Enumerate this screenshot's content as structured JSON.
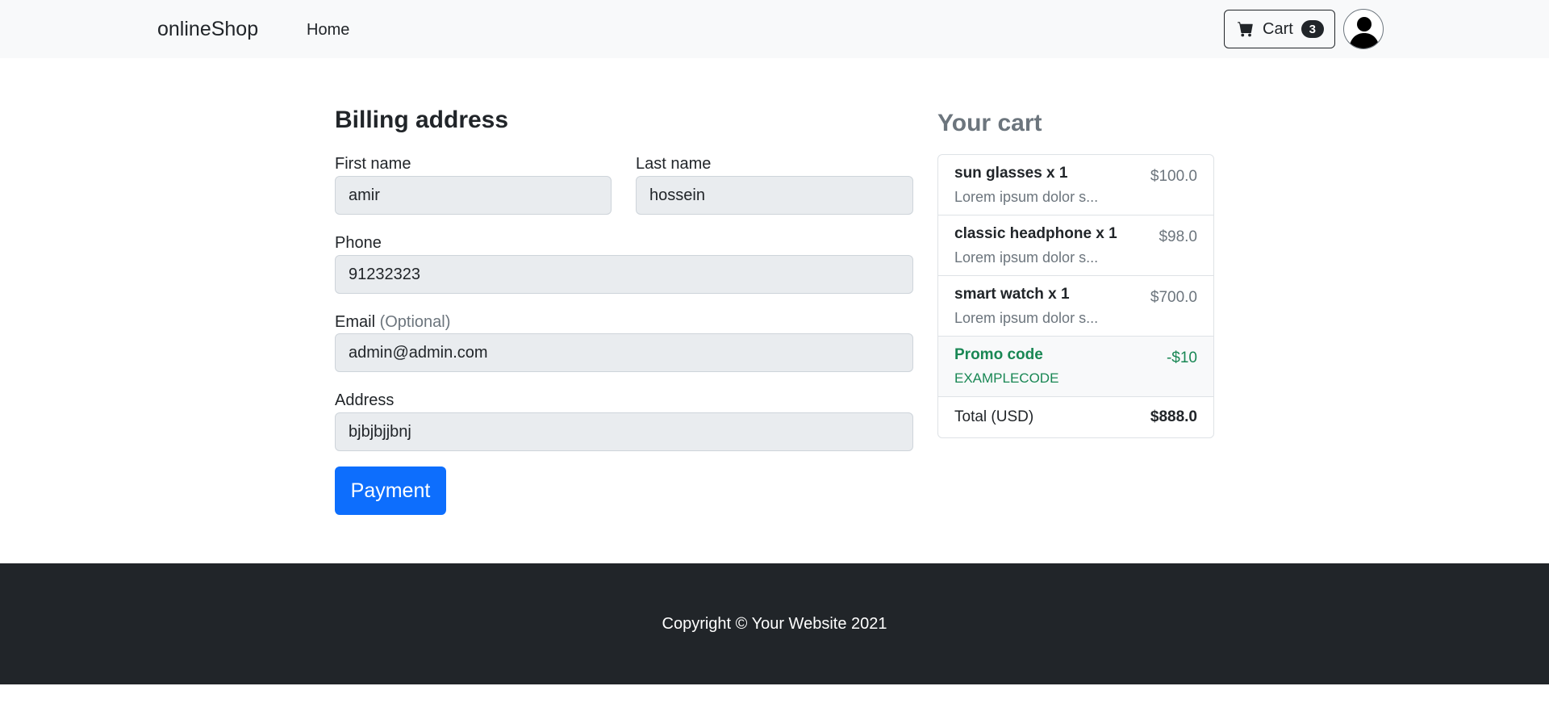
{
  "navbar": {
    "brand": "onlineShop",
    "home_link": "Home",
    "cart_label": "Cart",
    "cart_count": "3",
    "cart_icon": "cart-icon",
    "avatar_icon": "user-avatar-icon"
  },
  "billing": {
    "title": "Billing address",
    "first_name_label": "First name",
    "first_name_value": "amir",
    "last_name_label": "Last name",
    "last_name_value": "hossein",
    "phone_label": "Phone",
    "phone_value": "91232323",
    "email_label": "Email",
    "email_optional": "(Optional)",
    "email_value": "admin@admin.com",
    "address_label": "Address",
    "address_value": "bjbjbjjbnj",
    "payment_button": "Payment"
  },
  "cart": {
    "title": "Your cart",
    "items": [
      {
        "name": "sun glasses x 1",
        "desc": "Lorem ipsum dolor s...",
        "price": "$100.0"
      },
      {
        "name": "classic headphone x 1",
        "desc": "Lorem ipsum dolor s...",
        "price": "$98.0"
      },
      {
        "name": "smart watch x 1",
        "desc": "Lorem ipsum dolor s...",
        "price": "$700.0"
      }
    ],
    "promo": {
      "label": "Promo code",
      "code": "EXAMPLECODE",
      "discount": "-$10"
    },
    "total_label": "Total (USD)",
    "total_value": "$888.0"
  },
  "footer": {
    "copyright": "Copyright © Your Website 2021"
  },
  "colors": {
    "primary": "#0d6efd",
    "success": "#198754",
    "dark": "#212529",
    "muted": "#6c757d",
    "navbar_bg": "#f8f9fa"
  }
}
